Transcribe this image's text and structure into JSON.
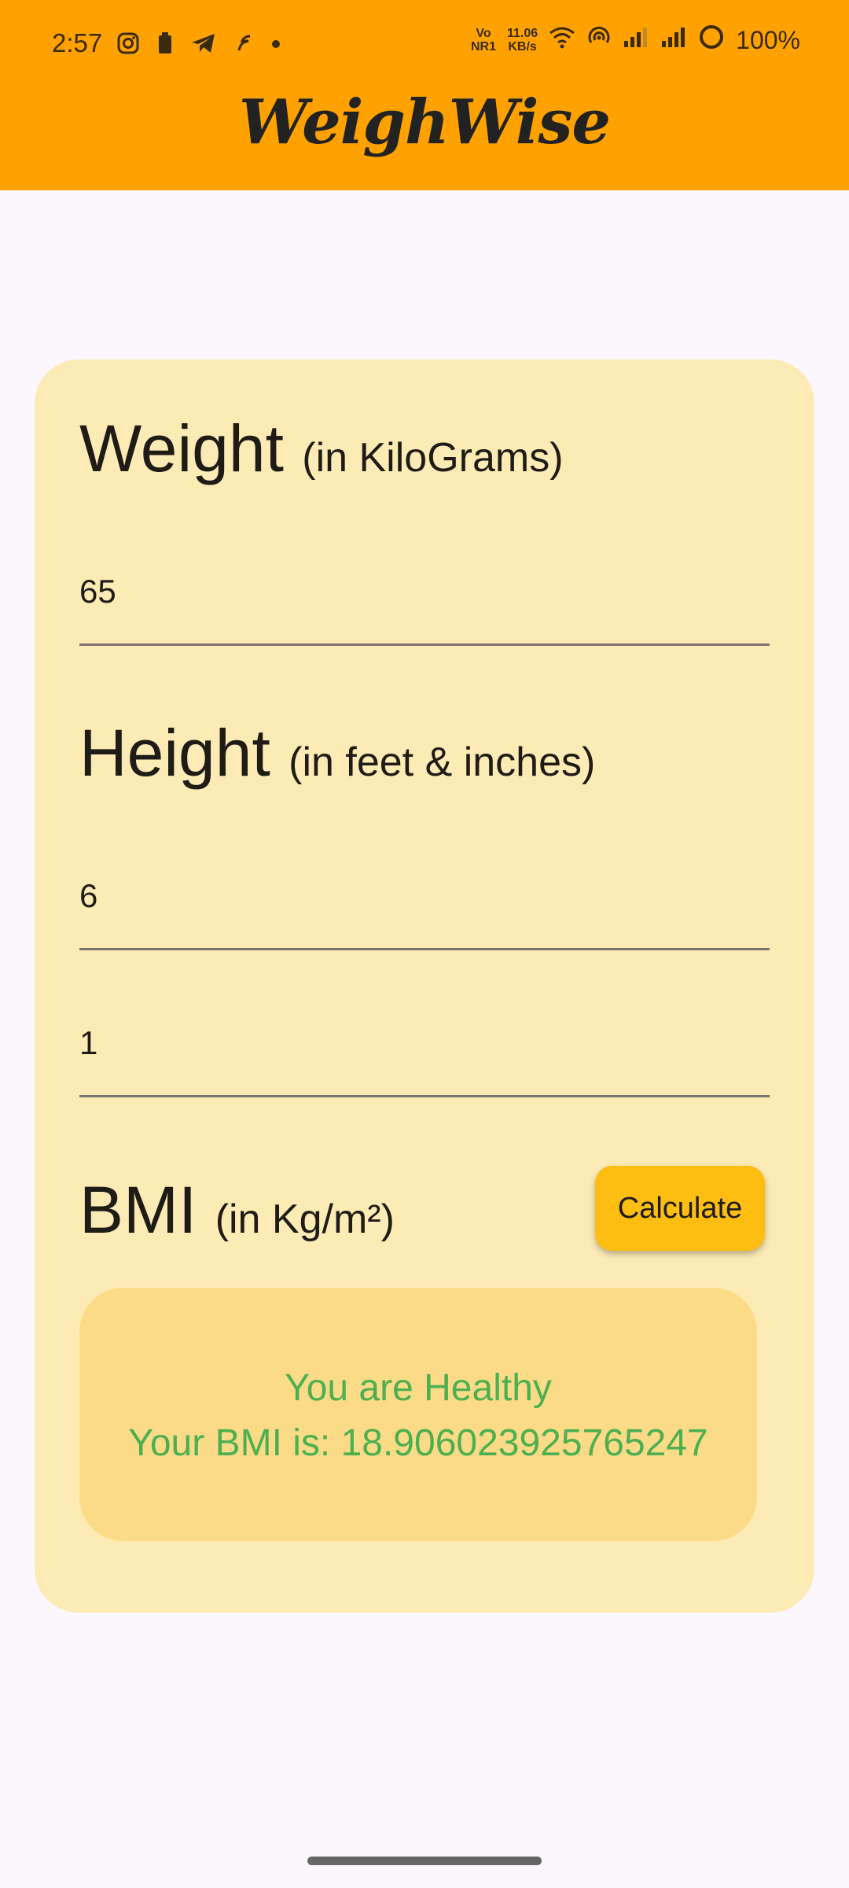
{
  "status_bar": {
    "time": "2:57",
    "network_top": "Vo",
    "network_bottom": "NR1",
    "speed_top": "11.06",
    "speed_bottom": "KB/s",
    "battery": "100%"
  },
  "app": {
    "title": "WeighWise"
  },
  "weight": {
    "label": "Weight",
    "unit": "(in KiloGrams)",
    "value": "65"
  },
  "height": {
    "label": "Height",
    "unit": "(in feet & inches)",
    "feet_value": "6",
    "inches_value": "1"
  },
  "bmi": {
    "label": "BMI",
    "unit": "(in Kg/m²)",
    "calculate_label": "Calculate",
    "status_text": "You are Healthy",
    "result_text": "Your BMI is: 18.906023925765247"
  },
  "colors": {
    "app_bar": "#FFA200",
    "card": "#FDEBB5",
    "result_box": "#FCDB88",
    "button": "#FDBD11",
    "result_text": "#4CAF50"
  }
}
